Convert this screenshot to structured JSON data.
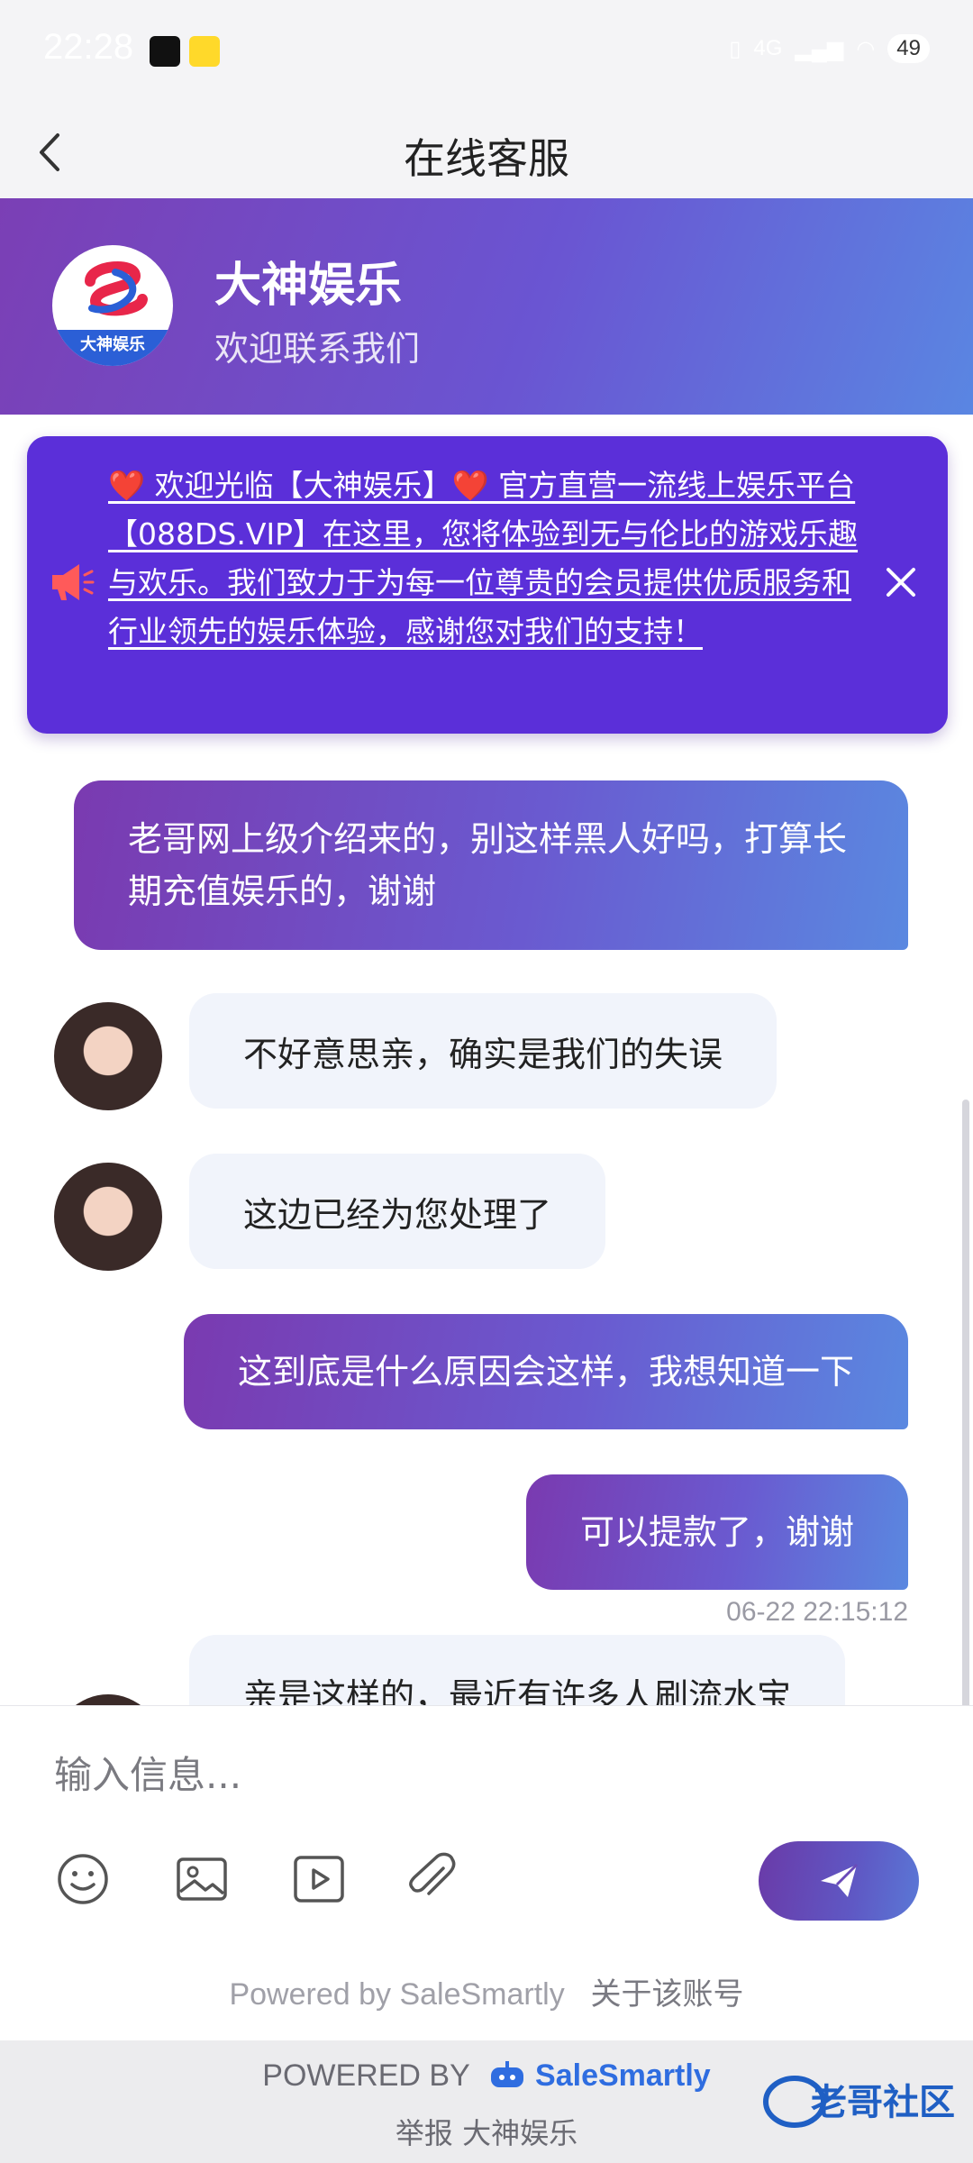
{
  "status_bar": {
    "time": "22:28",
    "battery": "49",
    "network": "4G"
  },
  "nav": {
    "title": "在线客服"
  },
  "header": {
    "brand_name": "大神娱乐",
    "subtitle": "欢迎联系我们",
    "logo_text": "大神娱乐"
  },
  "notice": {
    "text": "❤️ 欢迎光临【大神娱乐】❤️ 官方直营一流线上娱乐平台【088DS.VIP】在这里，您将体验到无与伦比的游戏乐趣与欢乐。我们致力于为每一位尊贵的会员提供优质服务和行业领先的娱乐体验，感谢您对我们的支持！"
  },
  "messages": [
    {
      "side": "out",
      "text": "老哥网上级介绍来的，别这样黑人好吗，打算长期充值娱乐的，谢谢"
    },
    {
      "side": "in",
      "text": "不好意思亲，确实是我们的失误"
    },
    {
      "side": "in",
      "text": "这边已经为您处理了"
    },
    {
      "side": "out",
      "text": "这到底是什么原因会这样，我想知道一下"
    },
    {
      "side": "out",
      "text": "可以提款了，谢谢",
      "timestamp": "06-22 22:15:12"
    },
    {
      "side": "in",
      "text": "亲是这样的，最近有许多人刷流水宝"
    }
  ],
  "composer": {
    "placeholder": "输入信息...",
    "powered_text": "Powered by SaleSmartly",
    "about_link": "关于该账号"
  },
  "footer": {
    "powered_label": "POWERED BY",
    "powered_brand": "SaleSmartly",
    "report_text": "举报 大神娱乐",
    "watermark_text": "老哥社区"
  },
  "colors": {
    "accent_purple": "#5b2fd9",
    "gradient_start": "#7a3ab0",
    "gradient_end": "#5a88e0"
  }
}
